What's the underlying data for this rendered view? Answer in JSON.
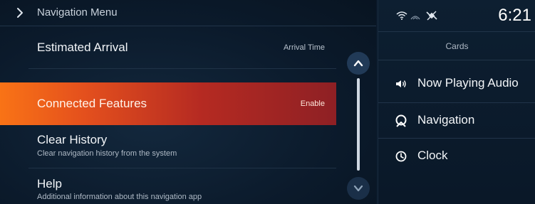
{
  "header": {
    "title": "Navigation Menu"
  },
  "menu": {
    "items": [
      {
        "title": "Estimated Arrival",
        "value": "Arrival Time"
      },
      {
        "title": "Connected Features",
        "value": "Enable"
      },
      {
        "title": "Clear History",
        "subtitle": "Clear navigation history from the system"
      },
      {
        "title": "Help",
        "subtitle": "Additional information about this navigation app"
      }
    ],
    "selected_index": 1
  },
  "status": {
    "time": "6:21"
  },
  "cards": {
    "title": "Cards",
    "items": [
      {
        "label": "Now Playing Audio",
        "icon": "speaker-icon"
      },
      {
        "label": "Navigation",
        "icon": "navigation-icon"
      },
      {
        "label": "Clock",
        "icon": "clock-icon"
      }
    ]
  },
  "colors": {
    "accent_orange": "#f97316",
    "accent_red": "#8e2024",
    "background": "#0b1a2b"
  }
}
